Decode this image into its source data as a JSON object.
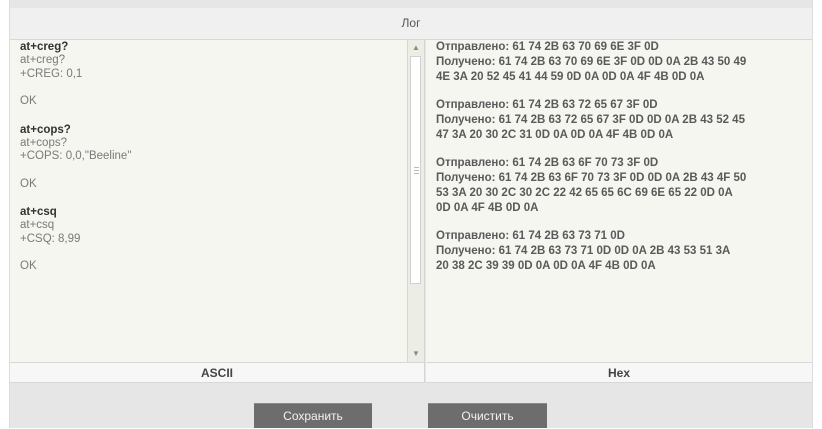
{
  "log": {
    "title": "Лог"
  },
  "ascii": {
    "label": "ASCII",
    "blocks": [
      {
        "command": "at+creg?",
        "lines": [
          "at+creg?",
          "+CREG: 0,1",
          "",
          "OK"
        ]
      },
      {
        "command": "at+cops?",
        "lines": [
          "at+cops?",
          "+COPS: 0,0,\"Beeline\"",
          "",
          "OK"
        ]
      },
      {
        "command": "at+csq",
        "lines": [
          "at+csq",
          "+CSQ: 8,99",
          "",
          "OK"
        ]
      }
    ]
  },
  "hex": {
    "label": "Hex",
    "blocks": [
      {
        "lines": [
          "Отправлено: 61 74 2B 63 70 69 6E 3F 0D",
          "Получено: 61 74 2B 63 70 69 6E 3F 0D 0D 0A 2B 43 50 49",
          "4E 3A 20 52 45 41 44 59 0D 0A 0D 0A 4F 4B 0D 0A"
        ]
      },
      {
        "lines": [
          "Отправлено: 61 74 2B 63 72 65 67 3F 0D",
          "Получено: 61 74 2B 63 72 65 67 3F 0D 0D 0A 2B 43 52 45",
          "47 3A 20 30 2C 31 0D 0A 0D 0A 4F 4B 0D 0A"
        ]
      },
      {
        "lines": [
          "Отправлено: 61 74 2B 63 6F 70 73 3F 0D",
          "Получено: 61 74 2B 63 6F 70 73 3F 0D 0D 0A 2B 43 4F 50",
          "53 3A 20 30 2C 30 2C 22 42 65 65 6C 69 6E 65 22 0D 0A",
          "0D 0A 4F 4B 0D 0A"
        ]
      },
      {
        "lines": [
          "Отправлено: 61 74 2B 63 73 71 0D",
          "Получено: 61 74 2B 63 73 71 0D 0D 0A 2B 43 53 51 3A",
          "20 38 2C 39 39 0D 0A 0D 0A 4F 4B 0D 0A"
        ]
      }
    ]
  },
  "buttons": {
    "save": "Сохранить",
    "clear": "Очистить"
  },
  "icons": {
    "scroll_up": "triangle-up-icon",
    "scroll_down": "triangle-down-icon",
    "grip": "scrollbar-grip-icon"
  }
}
